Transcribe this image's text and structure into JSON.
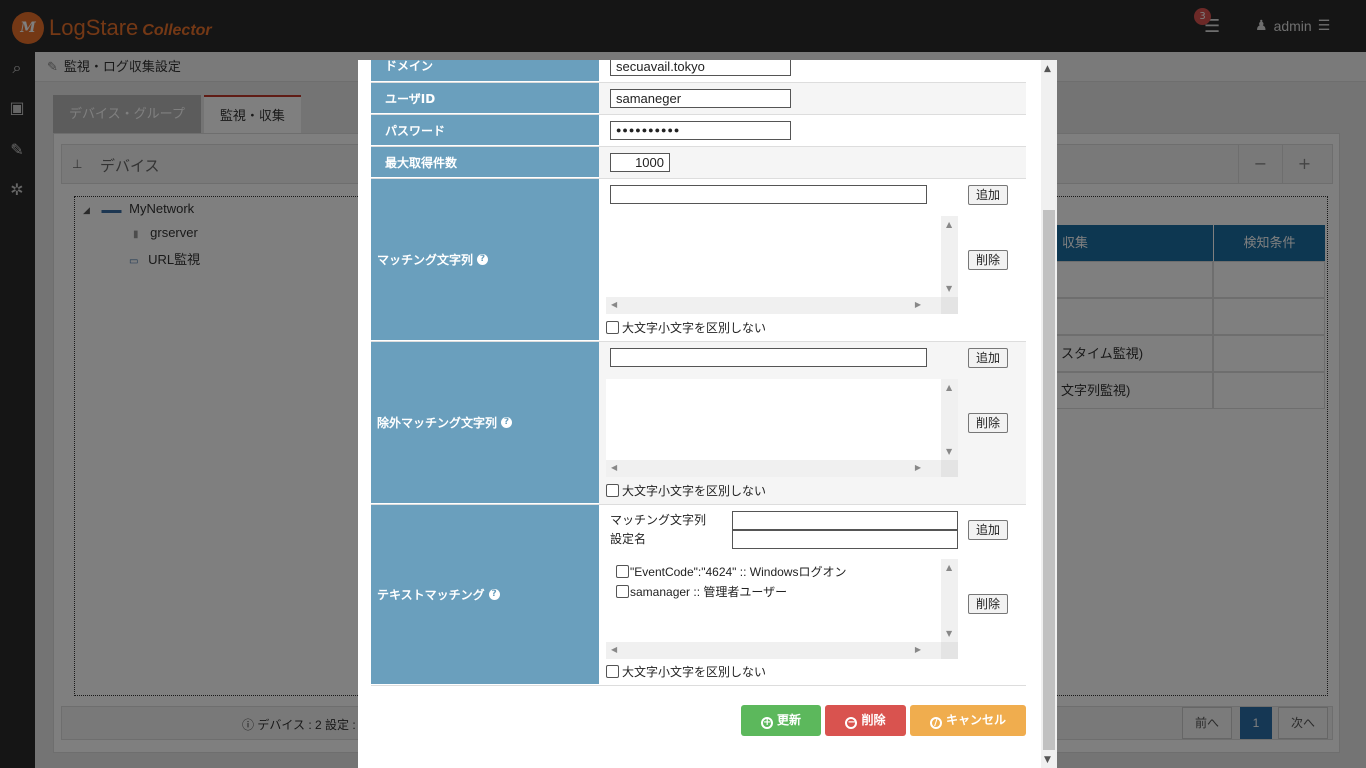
{
  "app": {
    "logo_mark": "M",
    "logo_name": "LogStare",
    "logo_sub": "Collector"
  },
  "header": {
    "tasks_badge": "3",
    "tasks_icon": "tasks-icon",
    "user_name": "admin",
    "user_icon": "user-icon",
    "menu_icon": "hamburger-icon"
  },
  "sidebar": {
    "items": [
      {
        "icon": "search-icon",
        "glyph": "⌕"
      },
      {
        "icon": "book-icon",
        "glyph": "▣"
      },
      {
        "icon": "wrench-icon",
        "glyph": "✎"
      },
      {
        "icon": "gears-icon",
        "glyph": "✲"
      }
    ]
  },
  "breadcrumb": {
    "title": "監視・ログ収集設定"
  },
  "tabs": [
    {
      "label": "デバイス・グループ"
    },
    {
      "label": "監視・収集"
    }
  ],
  "device_panel": {
    "title": "デバイス",
    "tree": [
      {
        "label": "MyNetwork",
        "icon": "network-icon"
      },
      {
        "label": "grserver",
        "icon": "server-icon"
      },
      {
        "label": "URL監視",
        "icon": "monitor-icon"
      }
    ],
    "columns": {
      "collect": "収集",
      "condition": "検知条件"
    },
    "row_texts": [
      "スタイム監視)",
      "文字列監視)"
    ],
    "footer": "デバイス : 2   設定 :",
    "pager": {
      "prev": "前へ",
      "current": "1",
      "next": "次へ"
    }
  },
  "modal": {
    "fields": {
      "domain": {
        "label": "ドメイン",
        "value": "secuavail.tokyo"
      },
      "user_id": {
        "label": "ユーザID",
        "value": "samaneger"
      },
      "password": {
        "label": "パスワード",
        "value": "●●●●●●●●●●"
      },
      "max_count": {
        "label": "最大取得件数",
        "value": "1000"
      }
    },
    "matching": {
      "label": "マッチング文字列",
      "add": "追加",
      "delete": "削除",
      "case_label": "大文字小文字を区別しない"
    },
    "exclude_matching": {
      "label": "除外マッチング文字列",
      "add": "追加",
      "delete": "削除",
      "case_label": "大文字小文字を区別しない"
    },
    "text_matching": {
      "label": "テキストマッチング",
      "matching_label": "マッチング文字列",
      "name_label": "設定名",
      "add": "追加",
      "delete": "削除",
      "items": [
        {
          "text": "\"EventCode\":\"4624\" :: Windowsログオン"
        },
        {
          "text": "samanager :: 管理者ユーザー"
        }
      ],
      "case_label": "大文字小文字を区別しない"
    },
    "actions": {
      "update": "更新",
      "delete": "削除",
      "cancel": "キャンセル"
    },
    "colors": {
      "update": "#5cb85c",
      "delete": "#d9534f",
      "cancel": "#f0ad4e",
      "label_bg": "#6a9fbd"
    }
  }
}
